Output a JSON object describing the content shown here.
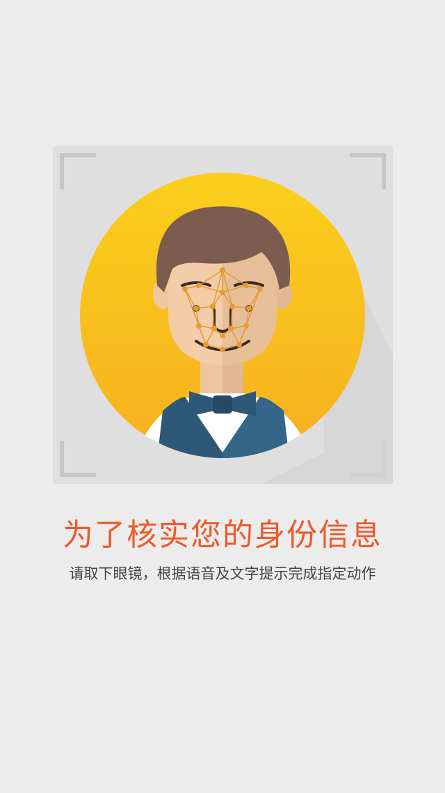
{
  "face_verification": {
    "headline": "为了核实您的身份信息",
    "instruction": "请取下眼镜，根据语音及文字提示完成指定动作"
  },
  "icons": {
    "frame_corners": "scan-frame-corner-icon",
    "avatar": "face-avatar-icon",
    "face_mesh": "face-recognition-mesh-icon"
  },
  "colors": {
    "background": "#ececec",
    "frame": "#dfdfdf",
    "frame_corner": "#c6c6c6",
    "avatar_circle": "#f8bd1e",
    "headline": "#ec5a2a",
    "instruction": "#444444",
    "mesh": "#e79a32",
    "hair": "#7b5c4e",
    "vest": "#2d5878"
  }
}
